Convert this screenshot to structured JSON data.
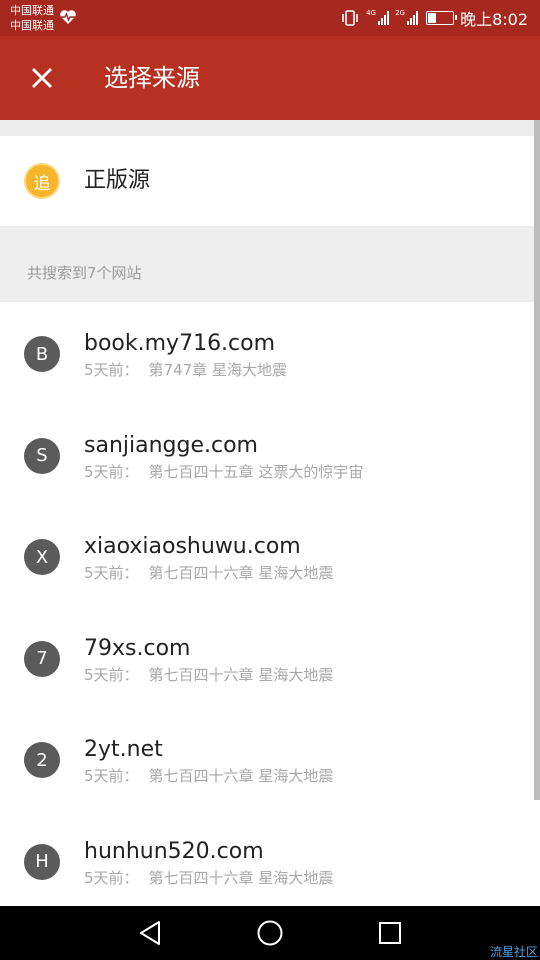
{
  "status_bar": {
    "carrier_1": "中国联通",
    "carrier_2": "中国联通",
    "signal_1_tag": "4G",
    "signal_2_tag": "2G",
    "time": "晚上8:02"
  },
  "app_bar": {
    "title": "选择来源",
    "close_icon": "close-icon"
  },
  "official": {
    "icon_glyph": "追",
    "label": "正版源",
    "accent": "#f6b52a"
  },
  "section_header": "共搜索到7个网站",
  "sources": [
    {
      "initial": "B",
      "domain": "book.my716.com",
      "time": "5天前：",
      "chapter": "第747章 星海大地震"
    },
    {
      "initial": "S",
      "domain": "sanjiangge.com",
      "time": "5天前：",
      "chapter": "第七百四十五章 这票大的惊宇宙"
    },
    {
      "initial": "X",
      "domain": "xiaoxiaoshuwu.com",
      "time": "5天前：",
      "chapter": "第七百四十六章 星海大地震"
    },
    {
      "initial": "7",
      "domain": "79xs.com",
      "time": "5天前：",
      "chapter": "第七百四十六章 星海大地震"
    },
    {
      "initial": "2",
      "domain": "2yt.net",
      "time": "5天前：",
      "chapter": "第七百四十六章 星海大地震"
    },
    {
      "initial": "H",
      "domain": "hunhun520.com",
      "time": "5天前：",
      "chapter": "第七百四十六章 星海大地震"
    }
  ],
  "nav_bar": {
    "back": "back-icon",
    "home": "home-icon",
    "recents": "recents-icon"
  },
  "watermark": "流星社区",
  "colors": {
    "status_bar": "#a7281f",
    "app_bar": "#b73123",
    "avatar": "#5b5b5b"
  }
}
